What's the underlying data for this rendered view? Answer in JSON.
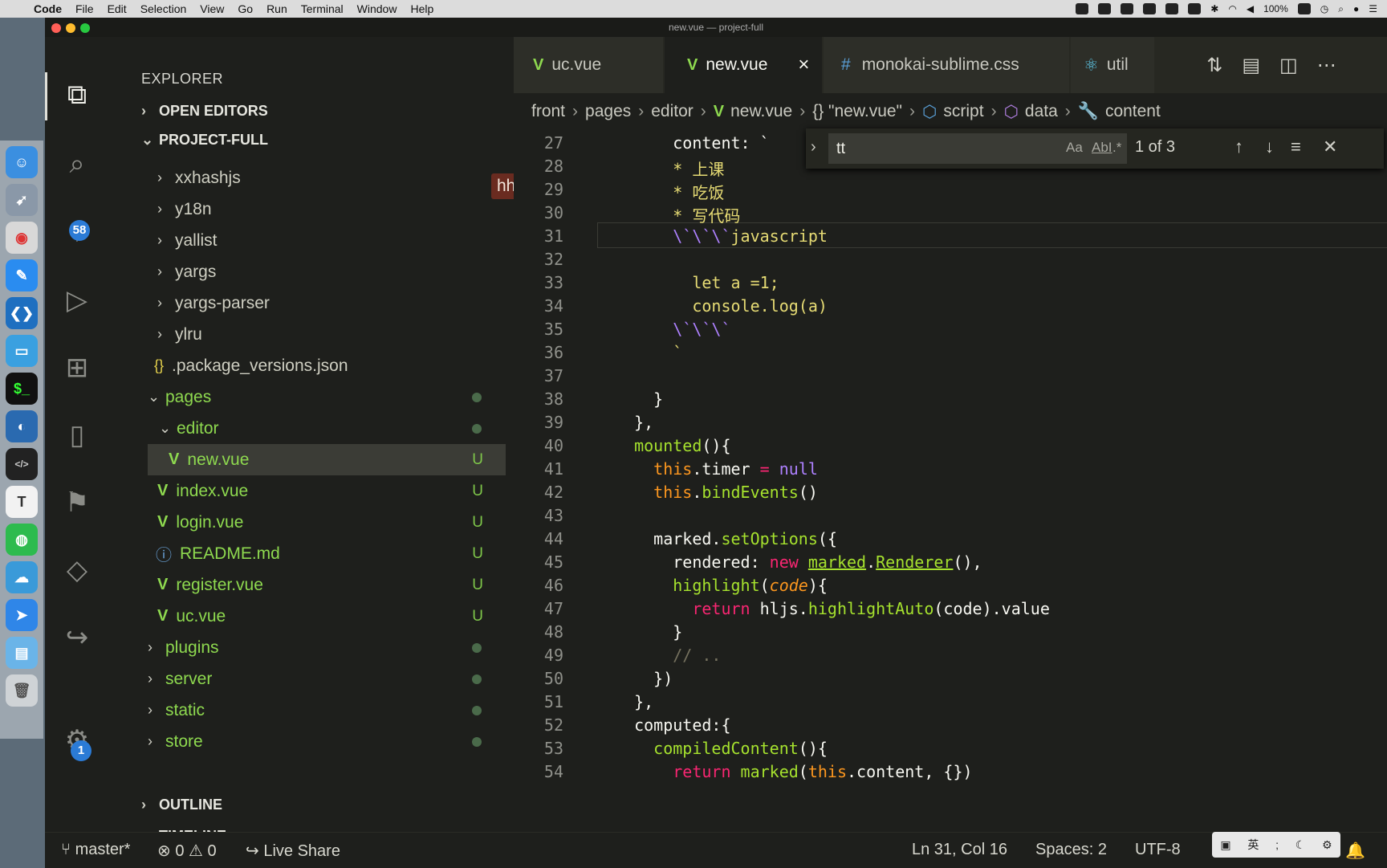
{
  "menubar": {
    "items": [
      "Code",
      "File",
      "Edit",
      "Selection",
      "View",
      "Go",
      "Run",
      "Terminal",
      "Window",
      "Help"
    ],
    "battery": "100%"
  },
  "window": {
    "title": "new.vue — project-full"
  },
  "activity": {
    "scm_badge": "58",
    "settings_badge": "1"
  },
  "sidebar": {
    "title": "EXPLORER",
    "open_editors": "OPEN EDITORS",
    "project": "PROJECT-FULL",
    "tag": "hhigh",
    "tree": [
      {
        "label": "xxhashjs",
        "kind": "folder",
        "status": ""
      },
      {
        "label": "y18n",
        "kind": "folder",
        "status": ""
      },
      {
        "label": "yallist",
        "kind": "folder",
        "status": ""
      },
      {
        "label": "yargs",
        "kind": "folder",
        "status": ""
      },
      {
        "label": "yargs-parser",
        "kind": "folder",
        "status": ""
      },
      {
        "label": "ylru",
        "kind": "folder",
        "status": ""
      },
      {
        "label": ".package_versions.json",
        "kind": "json",
        "status": ""
      },
      {
        "label": "pages",
        "kind": "folder-open",
        "status": "dot"
      },
      {
        "label": "editor",
        "kind": "folder-open",
        "status": "dot"
      },
      {
        "label": "new.vue",
        "kind": "vue",
        "status": "U"
      },
      {
        "label": "index.vue",
        "kind": "vue",
        "status": "U"
      },
      {
        "label": "login.vue",
        "kind": "vue",
        "status": "U"
      },
      {
        "label": "README.md",
        "kind": "info",
        "status": "U"
      },
      {
        "label": "register.vue",
        "kind": "vue",
        "status": "U"
      },
      {
        "label": "uc.vue",
        "kind": "vue",
        "status": "U"
      },
      {
        "label": "plugins",
        "kind": "folder",
        "status": "dot"
      },
      {
        "label": "server",
        "kind": "folder",
        "status": "dot"
      },
      {
        "label": "static",
        "kind": "folder",
        "status": "dot"
      },
      {
        "label": "store",
        "kind": "folder",
        "status": "dot"
      }
    ],
    "outline": "OUTLINE",
    "timeline": "TIMELINE"
  },
  "tabs": [
    {
      "label": "uc.vue",
      "icon": "vue"
    },
    {
      "label": "new.vue",
      "icon": "vue",
      "active": true
    },
    {
      "label": "monokai-sublime.css",
      "icon": "hash"
    },
    {
      "label": "util",
      "icon": "react"
    }
  ],
  "breadcrumb": [
    "front",
    "pages",
    "editor",
    "new.vue",
    "{} \"new.vue\"",
    "script",
    "data",
    "content"
  ],
  "find": {
    "query": "tt",
    "match_case": "Aa",
    "whole_word": "AbI",
    "regex": ".*",
    "count": "1 of 3"
  },
  "editor": {
    "line_numbers": [
      "27",
      "28",
      "29",
      "30",
      "31",
      "32",
      "33",
      "34",
      "35",
      "36",
      "37",
      "38",
      "39",
      "40",
      "41",
      "42",
      "43",
      "44",
      "45",
      "46",
      "47",
      "48",
      "49",
      "50",
      "51",
      "52",
      "53",
      "54"
    ]
  },
  "status": {
    "branch": "master*",
    "errors": "0",
    "warnings": "0",
    "live_share": "Live Share",
    "position": "Ln 31, Col 16",
    "spaces": "Spaces: 2",
    "encoding": "UTF-8",
    "ime": "英"
  }
}
